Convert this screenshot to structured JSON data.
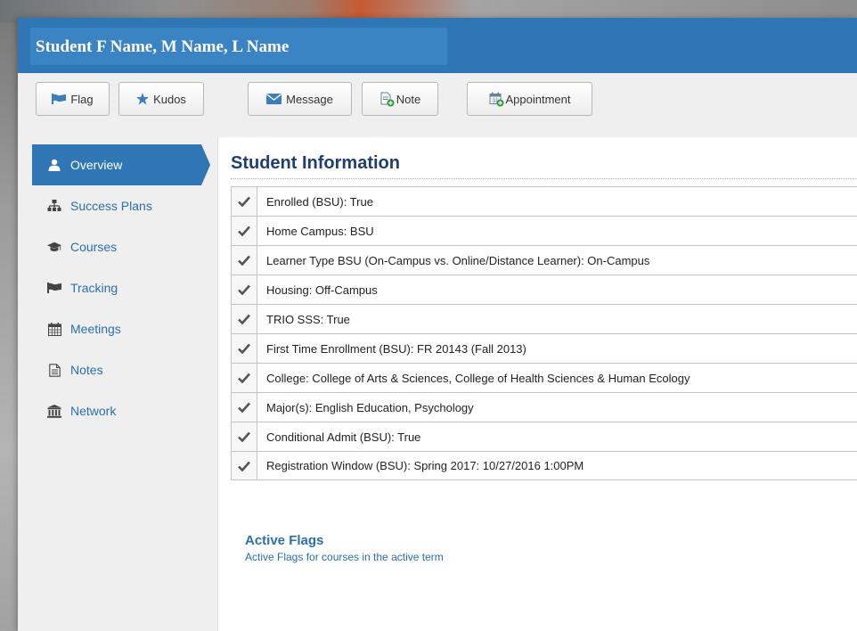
{
  "header": {
    "student_name": "Student F Name, M Name, L Name"
  },
  "toolbar": {
    "flag_label": "Flag",
    "kudos_label": "Kudos",
    "message_label": "Message",
    "note_label": "Note",
    "appointment_label": "Appointment"
  },
  "sidebar": {
    "active_color": "#2e76b4",
    "items": [
      {
        "label": "Overview",
        "icon": "user-icon",
        "active": true
      },
      {
        "label": "Success Plans",
        "icon": "sitemap-icon",
        "active": false
      },
      {
        "label": "Courses",
        "icon": "graduation-cap-icon",
        "active": false
      },
      {
        "label": "Tracking",
        "icon": "flag-icon",
        "active": false
      },
      {
        "label": "Meetings",
        "icon": "calendar-icon",
        "active": false
      },
      {
        "label": "Notes",
        "icon": "document-icon",
        "active": false
      },
      {
        "label": "Network",
        "icon": "institution-icon",
        "active": false
      }
    ]
  },
  "main": {
    "title": "Student Information",
    "info_rows": [
      "Enrolled (BSU): True",
      "Home Campus: BSU",
      "Learner Type BSU (On-Campus vs. Online/Distance Learner): On-Campus",
      "Housing: Off-Campus",
      "TRIO SSS: True",
      "First Time Enrollment (BSU): FR 20143 (Fall 2013)",
      "College: College of Arts & Sciences, College of Health Sciences & Human Ecology",
      "Major(s): English Education, Psychology",
      "Conditional Admit (BSU): True",
      "Registration Window (BSU): Spring 2017: 10/27/2016 1:00PM"
    ],
    "active_flags": {
      "title": "Active Flags",
      "subtitle": "Active Flags for courses in the active term"
    }
  }
}
